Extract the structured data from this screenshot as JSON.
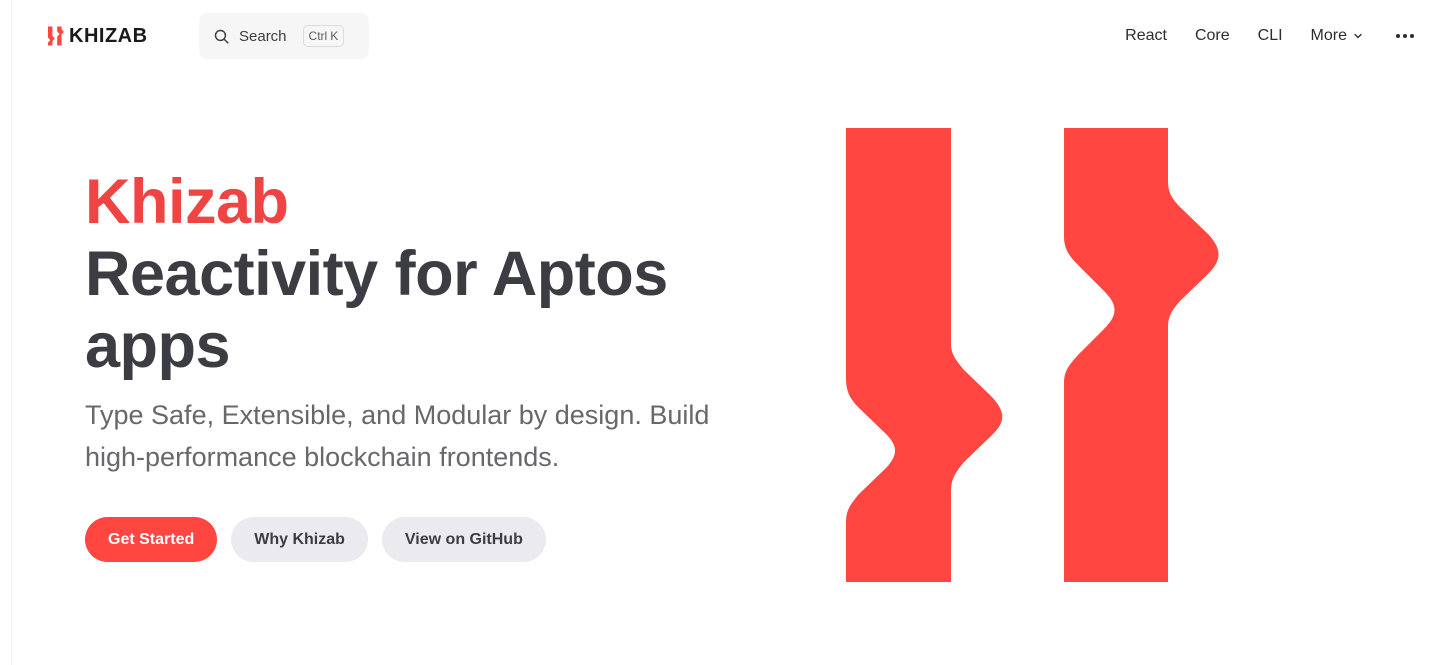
{
  "brand": {
    "name": "KHIZAB",
    "color": "#ff4640",
    "icon": "khizab-logo-icon"
  },
  "search": {
    "label": "Search",
    "shortcut_mod": "Ctrl",
    "shortcut_key": "K",
    "icon": "search-icon"
  },
  "nav": {
    "links": [
      {
        "label": "React"
      },
      {
        "label": "Core"
      },
      {
        "label": "CLI"
      },
      {
        "label": "More"
      }
    ],
    "overflow_icon": "ellipsis-icon"
  },
  "hero": {
    "name": "Khizab",
    "tagline": "Reactivity for Aptos apps",
    "description": "Type Safe, Extensible, and Modular by design. Build high-performance blockchain frontends."
  },
  "actions": {
    "get_started": "Get Started",
    "why": "Why Khizab",
    "github": "View on GitHub"
  },
  "colors": {
    "accent": "#ff4640",
    "heading_accent": "#ef4444",
    "text": "#3c3c43",
    "muted": "#67676c",
    "button_alt_bg": "#ebebef"
  }
}
